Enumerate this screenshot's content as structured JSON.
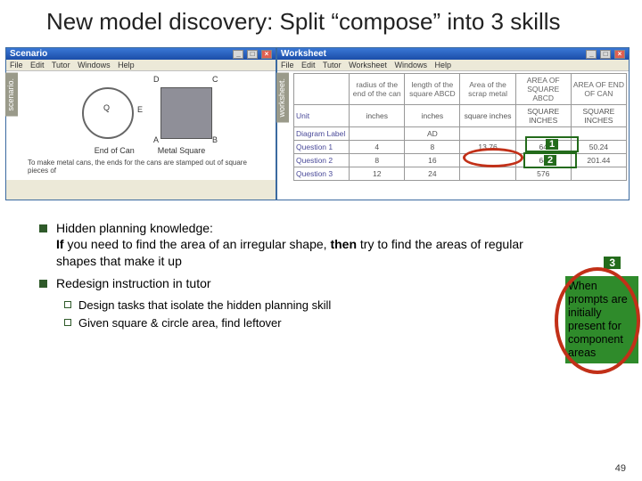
{
  "title": "New model discovery: Split “compose” into 3 skills",
  "scenario": {
    "win_title": "Scenario",
    "menus": [
      "File",
      "Edit",
      "Tutor",
      "Windows",
      "Help"
    ],
    "side_tab": "scenario.",
    "points": {
      "A": "A",
      "B": "B",
      "C": "C",
      "D": "D",
      "E": "E",
      "Q": "Q"
    },
    "labels": {
      "circle": "End of Can",
      "square": "Metal Square"
    },
    "caption": "To make metal cans, the ends for the cans are stamped out of square pieces of"
  },
  "worksheet": {
    "win_title": "Worksheet",
    "menus": [
      "File",
      "Edit",
      "Tutor",
      "Worksheet",
      "Windows",
      "Help"
    ],
    "side_tab": "worksheet.",
    "headers": [
      "",
      "radius of the end of the can",
      "length of the square ABCD",
      "Area of the scrap metal",
      "AREA OF SQUARE ABCD",
      "AREA OF END OF CAN"
    ],
    "rows": [
      {
        "hdr": "Unit",
        "cells": [
          "inches",
          "inches",
          "square inches",
          "SQUARE INCHES",
          "SQUARE INCHES"
        ]
      },
      {
        "hdr": "Diagram Label",
        "cells": [
          "",
          "AD",
          "",
          "",
          ""
        ]
      },
      {
        "hdr": "Question 1",
        "cells": [
          "4",
          "8",
          "13.76",
          "64",
          "50.24"
        ]
      },
      {
        "hdr": "Question 2",
        "cells": [
          "8",
          "16",
          "",
          "64",
          "201.44"
        ]
      },
      {
        "hdr": "Question 3",
        "cells": [
          "12",
          "24",
          "",
          "576",
          ""
        ]
      }
    ]
  },
  "overlays": {
    "one": "1",
    "two": "2",
    "three": "3"
  },
  "bullets": {
    "b1a": "Hidden planning knowledge:",
    "b1b": "If you need to find the area of an irregular shape, then try to find the areas of regular shapes that make it up",
    "b2": "Redesign instruction in tutor",
    "s1": "Design tasks that isolate the hidden planning skill",
    "s2": "Given square & circle area, find leftover"
  },
  "greenbox": "When prompts are initially present for component areas",
  "page": "49",
  "if_word": "If",
  "then_word": "then"
}
